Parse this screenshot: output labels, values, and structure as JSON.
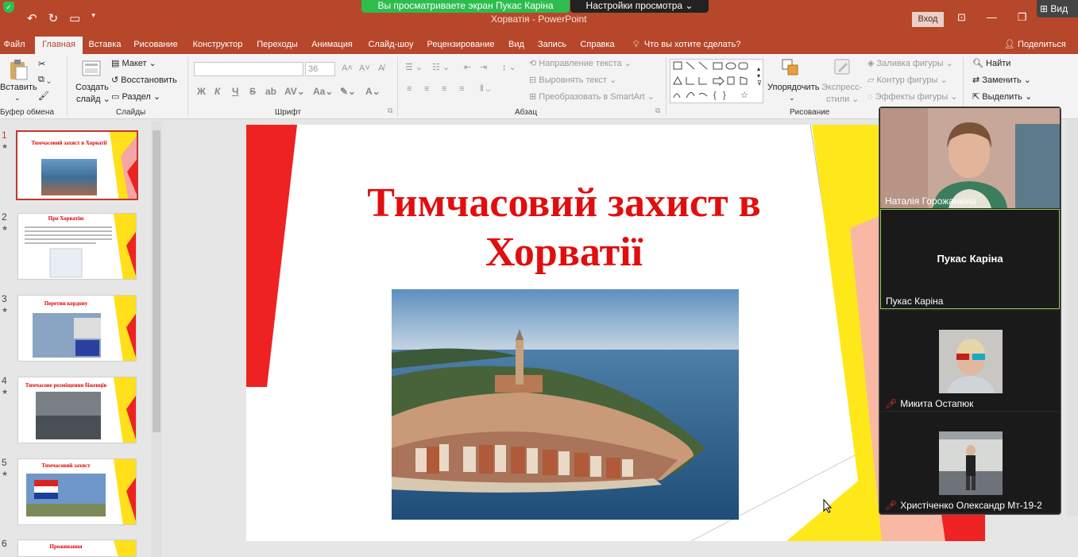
{
  "titlebar": {
    "title": "Хорватія  -  PowerPoint",
    "login": "Вход",
    "screen_share_banner": "Вы просматриваете экран Пукас Каріна",
    "view_settings": "Настройки просмотра",
    "view_button": "Вид",
    "quick_access": [
      "save-icon",
      "undo-icon",
      "redo-icon",
      "present-icon",
      "customize-icon"
    ]
  },
  "tabs": {
    "items": [
      "Файл",
      "Главная",
      "Вставка",
      "Рисование",
      "Конструктор",
      "Переходы",
      "Анимация",
      "Слайд-шоу",
      "Рецензирование",
      "Вид",
      "Запись",
      "Справка"
    ],
    "active": "Главная",
    "tell_me": "Что вы хотите сделать?",
    "share": "Поделиться"
  },
  "ribbon": {
    "clipboard": {
      "paste": "Вставить",
      "label": "Буфер обмена"
    },
    "slides": {
      "new_slide_line1": "Создать",
      "new_slide_line2": "слайд",
      "layout": "Макет",
      "reset": "Восстановить",
      "section": "Раздел",
      "label": "Слайды"
    },
    "font": {
      "size": "36",
      "bold": "Ж",
      "italic": "К",
      "underline": "Ч",
      "strike": "S",
      "label": "Шрифт"
    },
    "paragraph": {
      "text_direction": "Направление текста",
      "align_text": "Выровнять текст",
      "smartart": "Преобразовать в SmartArt",
      "label": "Абзац"
    },
    "drawing": {
      "arrange": "Упорядочить",
      "quick_styles_line1": "Экспресс-",
      "quick_styles_line2": "стили",
      "fill": "Заливка фигуры",
      "outline": "Контур фигуры",
      "effects": "Эффекты фигуры",
      "label": "Рисование"
    },
    "editing": {
      "find": "Найти",
      "replace": "Заменить",
      "select": "Выделить"
    }
  },
  "thumbnails": [
    {
      "num": "1",
      "title": "Тимчасовий захист в Хорватії"
    },
    {
      "num": "2",
      "title": "Про Хорватію"
    },
    {
      "num": "3",
      "title": "Перетин кордону"
    },
    {
      "num": "4",
      "title": "Тимчасове розміщення біженців"
    },
    {
      "num": "5",
      "title": "Тимчасовий захист"
    },
    {
      "num": "6",
      "title": "Проживання"
    }
  ],
  "slide": {
    "title": "Тимчасовий захист в Хорватії",
    "accent": "#e10e0e"
  },
  "participants": [
    {
      "name": "Наталія Горожанкіна",
      "muted": false,
      "video": true
    },
    {
      "name": "Пукас Каріна",
      "muted": false,
      "video": false,
      "active": true
    },
    {
      "name": "Микита Остапюк",
      "muted": true,
      "video": true
    },
    {
      "name": "Христіченко Олександр Мт-19-2",
      "muted": true,
      "video": true
    }
  ]
}
